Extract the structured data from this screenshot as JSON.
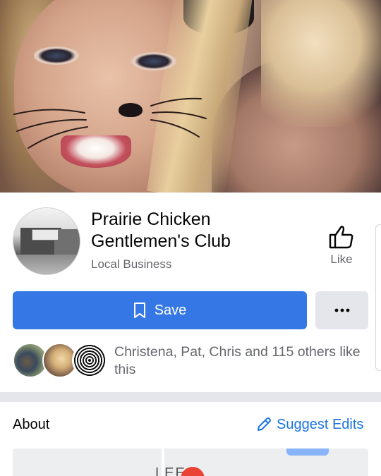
{
  "page": {
    "name": "Prairie Chicken Gentlemen's Club",
    "category": "Local Business"
  },
  "actions": {
    "like_label": "Like",
    "save_label": "Save"
  },
  "social": {
    "friends_like_text": "Christena, Pat, Chris and 115 others like this"
  },
  "about": {
    "title": "About",
    "suggest_edits_label": "Suggest Edits"
  },
  "map": {
    "label_fragment": "LEE"
  },
  "colors": {
    "primary_blue": "#3578e5",
    "link_blue": "#1b74e4",
    "secondary_text": "#65676b",
    "button_gray": "#e4e6eb"
  },
  "icons": {
    "like": "thumbs-up-icon",
    "save": "bookmark-icon",
    "more": "more-dots-icon",
    "edit": "pencil-icon",
    "map_pin": "map-pin-icon"
  }
}
